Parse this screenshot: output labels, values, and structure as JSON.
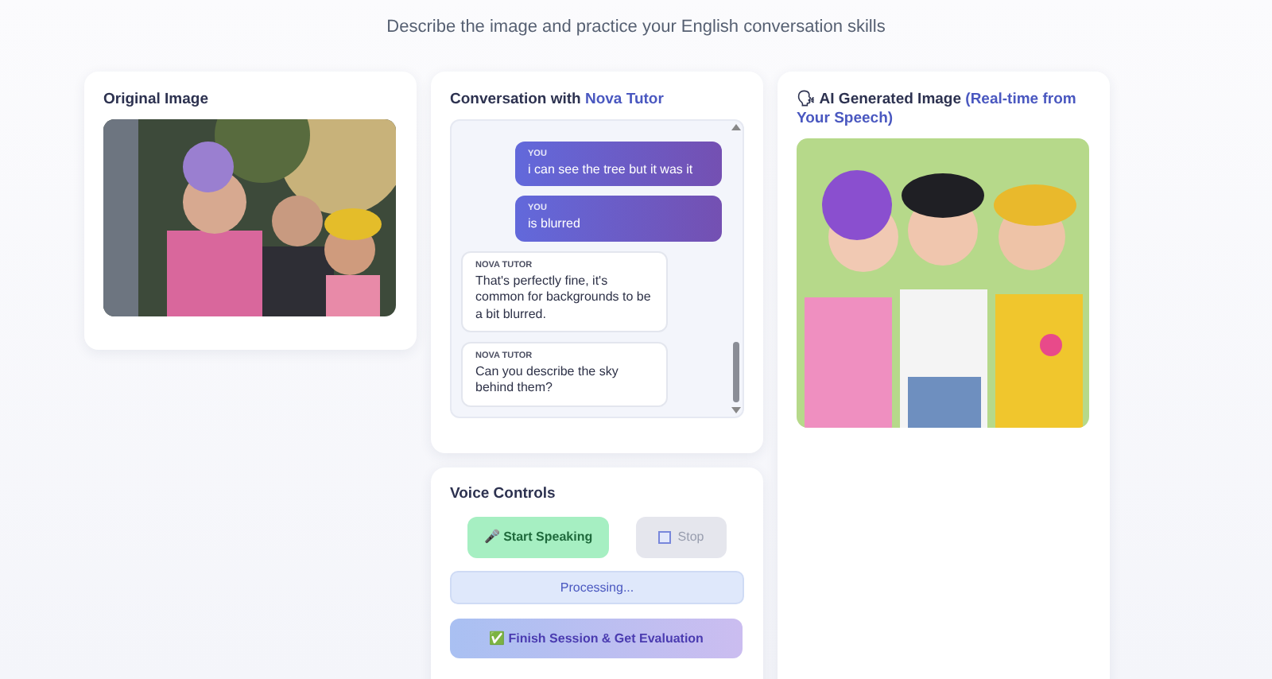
{
  "subtitle": "Describe the image and practice your English conversation skills",
  "original": {
    "title": "Original Image"
  },
  "conversation": {
    "title": "Conversation with ",
    "tutor_name": "Nova Tutor",
    "messages": [
      {
        "kind": "user",
        "speaker": "YOU",
        "text": "i can see the tree but it was it"
      },
      {
        "kind": "user",
        "speaker": "YOU",
        "text": "is blurred"
      },
      {
        "kind": "tutor",
        "speaker": "NOVA TUTOR",
        "text": "That's perfectly fine, it's common for backgrounds to be a bit blurred."
      },
      {
        "kind": "tutor",
        "speaker": "NOVA TUTOR",
        "text": "Can you describe the sky behind them?"
      }
    ]
  },
  "voice": {
    "title": "Voice Controls",
    "start": {
      "icon": "🎤",
      "label": "Start Speaking",
      "disabled": false
    },
    "stop": {
      "label": "Stop",
      "disabled": true
    },
    "status": "Processing...",
    "finish": {
      "icon": "✅",
      "label": "Finish Session & Get Evaluation"
    }
  },
  "generated": {
    "icon": "🗣",
    "title": "AI Generated Image ",
    "note": "(Real-time from Your Speech)"
  }
}
